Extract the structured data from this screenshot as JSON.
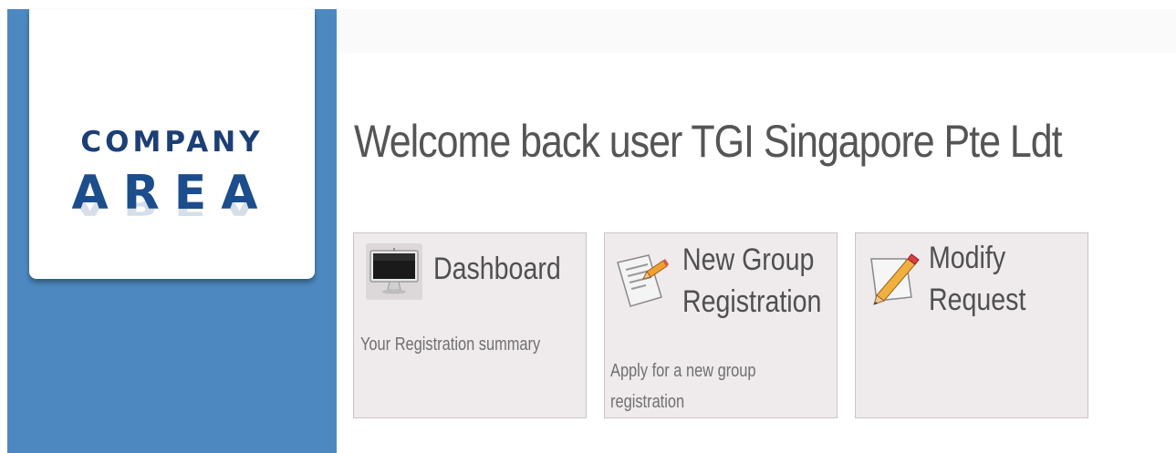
{
  "logo": {
    "line1": "COMPANY",
    "line2": "AREA"
  },
  "header": {
    "welcome": "Welcome back user TGI Singapore Pte Ldt"
  },
  "tiles": [
    {
      "icon": "monitor-icon",
      "title_lines": [
        "Dashboard"
      ],
      "description_lines": [
        "Your Registration summary"
      ]
    },
    {
      "icon": "document-edit-icon",
      "title_lines": [
        "New Group",
        "Registration"
      ],
      "description_lines": [
        "Apply for a new group",
        "registration"
      ]
    },
    {
      "icon": "pencil-icon",
      "title_lines": [
        "Modify",
        "Request"
      ],
      "description_lines": []
    }
  ],
  "colors": {
    "sidebar": "#4d89c0",
    "logo_text": "#1c4d8c",
    "tile_background": "#efeaec",
    "heading_text": "#555555"
  }
}
